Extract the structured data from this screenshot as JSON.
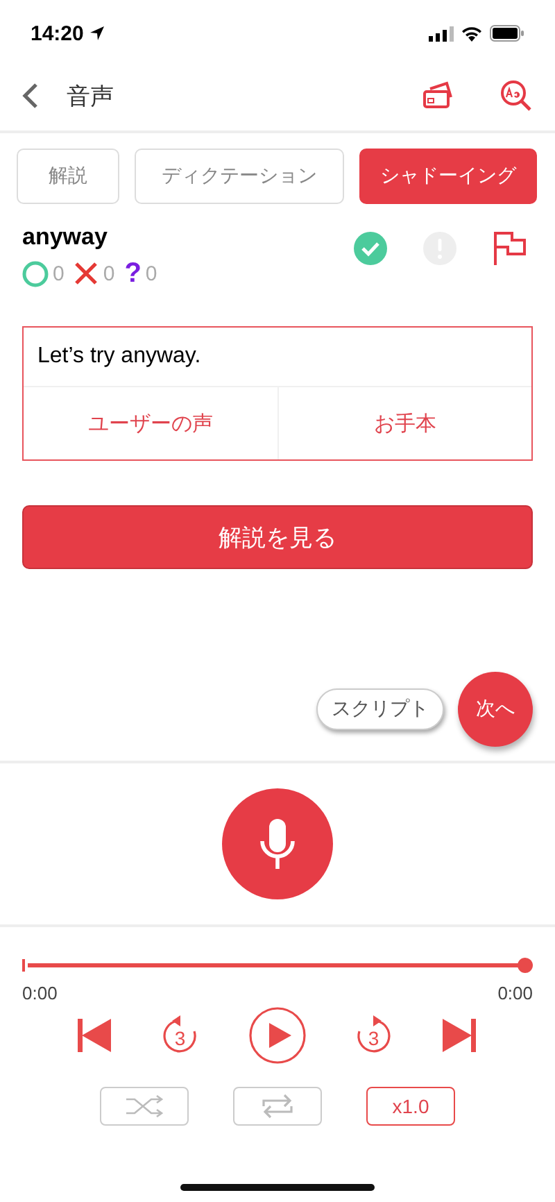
{
  "status_bar": {
    "time": "14:20"
  },
  "nav": {
    "title": "音声"
  },
  "tabs": [
    {
      "label": "解説",
      "selected": false
    },
    {
      "label": "ディクテーション",
      "selected": false
    },
    {
      "label": "シャドーイング",
      "selected": true
    }
  ],
  "word": {
    "text": "anyway",
    "counts": [
      {
        "kind": "correct",
        "color": "#4ccb9c",
        "count": "0"
      },
      {
        "kind": "wrong",
        "color": "#e53935",
        "count": "0"
      },
      {
        "kind": "unsure",
        "color": "#7a1ee0",
        "symbol": "?",
        "count": "0"
      }
    ],
    "marks": [
      {
        "kind": "check",
        "on": true
      },
      {
        "kind": "alert",
        "on": false
      },
      {
        "kind": "flag",
        "on": false
      }
    ]
  },
  "sentence": {
    "text": "Let’s try anyway.",
    "buttons": [
      "ユーザーの声",
      "お手本"
    ]
  },
  "explain_button": "解説を見る",
  "script_button": "スクリプト",
  "next_button": "次へ",
  "player": {
    "level": 1,
    "elapsed": "0:00",
    "total": "0:00",
    "controls": [
      {
        "kind": "prev"
      },
      {
        "kind": "back",
        "label": "3"
      },
      {
        "kind": "play"
      },
      {
        "kind": "forward",
        "label": "3"
      },
      {
        "kind": "next"
      }
    ],
    "shuffle": false,
    "repeat": false,
    "speed": "x1.0"
  }
}
